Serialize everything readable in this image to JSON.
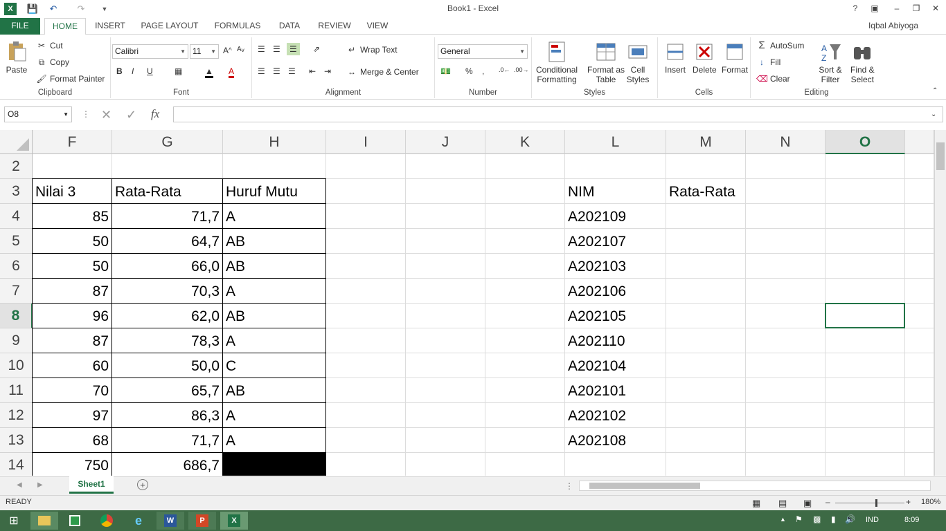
{
  "window": {
    "title": "Book1 - Excel",
    "user": "Iqbal Abiyoga"
  },
  "tabs": [
    "FILE",
    "HOME",
    "INSERT",
    "PAGE LAYOUT",
    "FORMULAS",
    "DATA",
    "REVIEW",
    "VIEW"
  ],
  "ribbon": {
    "clipboard": {
      "paste": "Paste",
      "cut": "Cut",
      "copy": "Copy",
      "format_painter": "Format Painter",
      "label": "Clipboard"
    },
    "font": {
      "name": "Calibri",
      "size": "11",
      "bold": "B",
      "italic": "I",
      "underline": "U",
      "label": "Font"
    },
    "alignment": {
      "wrap": "Wrap Text",
      "merge": "Merge & Center",
      "label": "Alignment"
    },
    "number": {
      "format": "General",
      "percent": "%",
      "comma": ",",
      "label": "Number"
    },
    "styles": {
      "conditional": "Conditional",
      "conditional2": "Formatting",
      "format_table": "Format as",
      "format_table2": "Table",
      "cell_styles": "Cell",
      "cell_styles2": "Styles",
      "label": "Styles"
    },
    "cells": {
      "insert": "Insert",
      "delete": "Delete",
      "format": "Format",
      "label": "Cells"
    },
    "editing": {
      "autosum": "AutoSum",
      "fill": "Fill",
      "clear": "Clear",
      "sort": "Sort &",
      "sort2": "Filter",
      "find": "Find &",
      "find2": "Select",
      "label": "Editing"
    }
  },
  "formula_bar": {
    "name_box": "O8",
    "fx": "fx",
    "value": ""
  },
  "columns": [
    "F",
    "G",
    "H",
    "I",
    "J",
    "K",
    "L",
    "M",
    "N",
    "O"
  ],
  "rows": [
    "2",
    "3",
    "4",
    "5",
    "6",
    "7",
    "8",
    "9",
    "10",
    "11",
    "12",
    "13",
    "14"
  ],
  "cells": {
    "F3": "Nilai 3",
    "G3": "Rata-Rata",
    "H3": "Huruf Mutu",
    "L3": "NIM",
    "M3": "Rata-Rata",
    "F4": "85",
    "G4": "71,7",
    "H4": "A",
    "L4": "A202109",
    "F5": "50",
    "G5": "64,7",
    "H5": "AB",
    "L5": "A202107",
    "F6": "50",
    "G6": "66,0",
    "H6": "AB",
    "L6": "A202103",
    "F7": "87",
    "G7": "70,3",
    "H7": "A",
    "L7": "A202106",
    "F8": "96",
    "G8": "62,0",
    "H8": "AB",
    "L8": "A202105",
    "F9": "87",
    "G9": "78,3",
    "H9": "A",
    "L9": "A202110",
    "F10": "60",
    "G10": "50,0",
    "H10": "C",
    "L10": "A202104",
    "F11": "70",
    "G11": "65,7",
    "H11": "AB",
    "L11": "A202101",
    "F12": "97",
    "G12": "86,3",
    "H12": "A",
    "L12": "A202102",
    "F13": "68",
    "G13": "71,7",
    "H13": "A",
    "L13": "A202108",
    "F14": "750",
    "G14": "686,7"
  },
  "sheet": {
    "name": "Sheet1"
  },
  "status": {
    "mode": "READY",
    "zoom": "180%"
  },
  "taskbar": {
    "lang": "IND",
    "time": "8:09"
  }
}
